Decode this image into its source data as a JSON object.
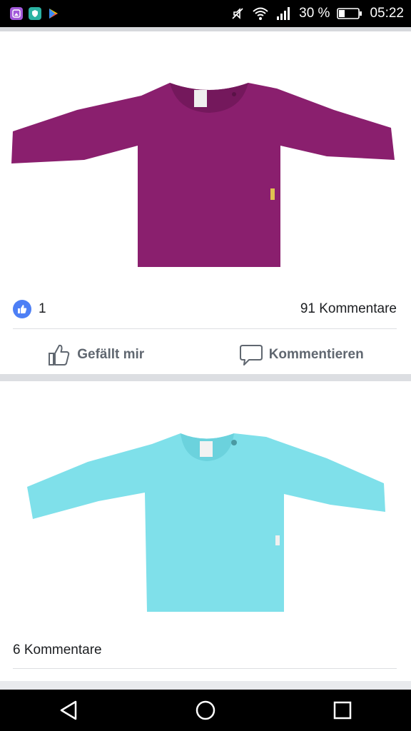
{
  "status_bar": {
    "battery_percent": "30 %",
    "time": "05:22",
    "notification_icons": [
      "gallery-app-icon",
      "shield-app-icon",
      "play-store-icon"
    ],
    "status_icons": [
      "mute-icon",
      "wifi-icon",
      "signal-icon",
      "battery-icon"
    ]
  },
  "posts": [
    {
      "image": "purple-long-sleeve-shirt",
      "shirt_color": "#8a1f6e",
      "like_count": "1",
      "comment_count": "91 Kommentare",
      "like_label": "Gefällt mir",
      "comment_label": "Kommentieren"
    },
    {
      "image": "light-blue-long-sleeve-shirt",
      "shirt_color": "#7fe0ea",
      "comment_count": "6 Kommentare"
    }
  ],
  "navigation": {
    "buttons": [
      "back-icon",
      "home-icon",
      "recents-icon"
    ]
  },
  "colors": {
    "like_blue": "#4d7ff5",
    "action_gray": "#606770"
  }
}
